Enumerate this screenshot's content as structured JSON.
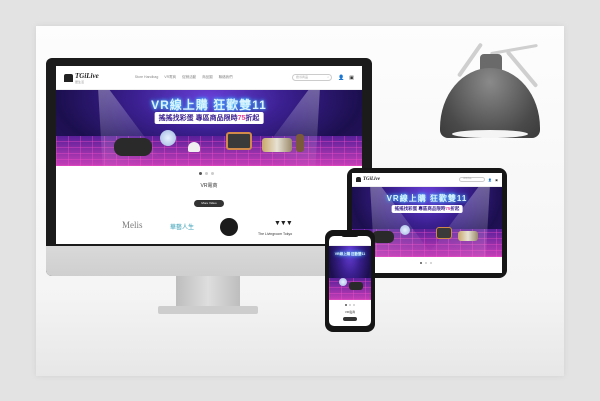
{
  "site": {
    "logo_text": "TGiLive",
    "logo_sub": "居生活",
    "menu": [
      "Store Handbag",
      "VR電商",
      "促銷活動",
      "商品圖",
      "聯絡我們"
    ],
    "search_placeholder": "搜尋商品",
    "icons": [
      "search-icon",
      "user-icon",
      "cart-icon"
    ]
  },
  "banner": {
    "title": "VR線上購 狂歡雙11",
    "subtitle_pre": "搖搖找彩蛋  專區商品限時",
    "subtitle_accent": "75",
    "subtitle_post": "折起"
  },
  "content": {
    "section_title": "VR電商",
    "more_button": "More Video",
    "brands": [
      "Melis",
      "華藝人生",
      "The Livingroom Tokyo"
    ]
  },
  "phone": {
    "section_title": "VR電商"
  },
  "colors": {
    "banner_deep": "#1c0f4f",
    "banner_purple": "#6a3fd8",
    "accent_pink": "#e8449c",
    "neon_blue": "#4fd3ff",
    "lamp_gray": "#4a4a4a"
  }
}
